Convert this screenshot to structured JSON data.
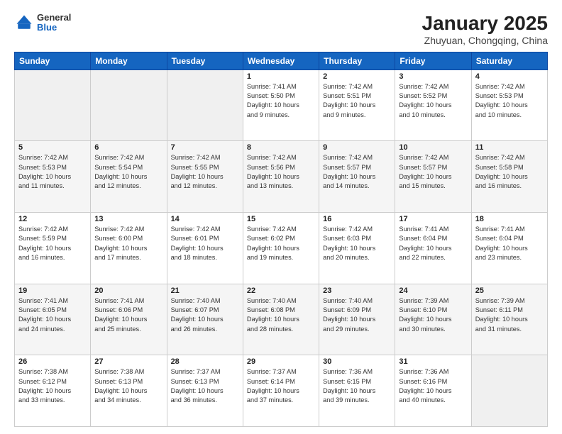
{
  "header": {
    "logo_general": "General",
    "logo_blue": "Blue",
    "month_title": "January 2025",
    "location": "Zhuyuan, Chongqing, China"
  },
  "days_of_week": [
    "Sunday",
    "Monday",
    "Tuesday",
    "Wednesday",
    "Thursday",
    "Friday",
    "Saturday"
  ],
  "weeks": [
    [
      {
        "day": "",
        "info": ""
      },
      {
        "day": "",
        "info": ""
      },
      {
        "day": "",
        "info": ""
      },
      {
        "day": "1",
        "info": "Sunrise: 7:41 AM\nSunset: 5:50 PM\nDaylight: 10 hours\nand 9 minutes."
      },
      {
        "day": "2",
        "info": "Sunrise: 7:42 AM\nSunset: 5:51 PM\nDaylight: 10 hours\nand 9 minutes."
      },
      {
        "day": "3",
        "info": "Sunrise: 7:42 AM\nSunset: 5:52 PM\nDaylight: 10 hours\nand 10 minutes."
      },
      {
        "day": "4",
        "info": "Sunrise: 7:42 AM\nSunset: 5:53 PM\nDaylight: 10 hours\nand 10 minutes."
      }
    ],
    [
      {
        "day": "5",
        "info": "Sunrise: 7:42 AM\nSunset: 5:53 PM\nDaylight: 10 hours\nand 11 minutes."
      },
      {
        "day": "6",
        "info": "Sunrise: 7:42 AM\nSunset: 5:54 PM\nDaylight: 10 hours\nand 12 minutes."
      },
      {
        "day": "7",
        "info": "Sunrise: 7:42 AM\nSunset: 5:55 PM\nDaylight: 10 hours\nand 12 minutes."
      },
      {
        "day": "8",
        "info": "Sunrise: 7:42 AM\nSunset: 5:56 PM\nDaylight: 10 hours\nand 13 minutes."
      },
      {
        "day": "9",
        "info": "Sunrise: 7:42 AM\nSunset: 5:57 PM\nDaylight: 10 hours\nand 14 minutes."
      },
      {
        "day": "10",
        "info": "Sunrise: 7:42 AM\nSunset: 5:57 PM\nDaylight: 10 hours\nand 15 minutes."
      },
      {
        "day": "11",
        "info": "Sunrise: 7:42 AM\nSunset: 5:58 PM\nDaylight: 10 hours\nand 16 minutes."
      }
    ],
    [
      {
        "day": "12",
        "info": "Sunrise: 7:42 AM\nSunset: 5:59 PM\nDaylight: 10 hours\nand 16 minutes."
      },
      {
        "day": "13",
        "info": "Sunrise: 7:42 AM\nSunset: 6:00 PM\nDaylight: 10 hours\nand 17 minutes."
      },
      {
        "day": "14",
        "info": "Sunrise: 7:42 AM\nSunset: 6:01 PM\nDaylight: 10 hours\nand 18 minutes."
      },
      {
        "day": "15",
        "info": "Sunrise: 7:42 AM\nSunset: 6:02 PM\nDaylight: 10 hours\nand 19 minutes."
      },
      {
        "day": "16",
        "info": "Sunrise: 7:42 AM\nSunset: 6:03 PM\nDaylight: 10 hours\nand 20 minutes."
      },
      {
        "day": "17",
        "info": "Sunrise: 7:41 AM\nSunset: 6:04 PM\nDaylight: 10 hours\nand 22 minutes."
      },
      {
        "day": "18",
        "info": "Sunrise: 7:41 AM\nSunset: 6:04 PM\nDaylight: 10 hours\nand 23 minutes."
      }
    ],
    [
      {
        "day": "19",
        "info": "Sunrise: 7:41 AM\nSunset: 6:05 PM\nDaylight: 10 hours\nand 24 minutes."
      },
      {
        "day": "20",
        "info": "Sunrise: 7:41 AM\nSunset: 6:06 PM\nDaylight: 10 hours\nand 25 minutes."
      },
      {
        "day": "21",
        "info": "Sunrise: 7:40 AM\nSunset: 6:07 PM\nDaylight: 10 hours\nand 26 minutes."
      },
      {
        "day": "22",
        "info": "Sunrise: 7:40 AM\nSunset: 6:08 PM\nDaylight: 10 hours\nand 28 minutes."
      },
      {
        "day": "23",
        "info": "Sunrise: 7:40 AM\nSunset: 6:09 PM\nDaylight: 10 hours\nand 29 minutes."
      },
      {
        "day": "24",
        "info": "Sunrise: 7:39 AM\nSunset: 6:10 PM\nDaylight: 10 hours\nand 30 minutes."
      },
      {
        "day": "25",
        "info": "Sunrise: 7:39 AM\nSunset: 6:11 PM\nDaylight: 10 hours\nand 31 minutes."
      }
    ],
    [
      {
        "day": "26",
        "info": "Sunrise: 7:38 AM\nSunset: 6:12 PM\nDaylight: 10 hours\nand 33 minutes."
      },
      {
        "day": "27",
        "info": "Sunrise: 7:38 AM\nSunset: 6:13 PM\nDaylight: 10 hours\nand 34 minutes."
      },
      {
        "day": "28",
        "info": "Sunrise: 7:37 AM\nSunset: 6:13 PM\nDaylight: 10 hours\nand 36 minutes."
      },
      {
        "day": "29",
        "info": "Sunrise: 7:37 AM\nSunset: 6:14 PM\nDaylight: 10 hours\nand 37 minutes."
      },
      {
        "day": "30",
        "info": "Sunrise: 7:36 AM\nSunset: 6:15 PM\nDaylight: 10 hours\nand 39 minutes."
      },
      {
        "day": "31",
        "info": "Sunrise: 7:36 AM\nSunset: 6:16 PM\nDaylight: 10 hours\nand 40 minutes."
      },
      {
        "day": "",
        "info": ""
      }
    ]
  ]
}
